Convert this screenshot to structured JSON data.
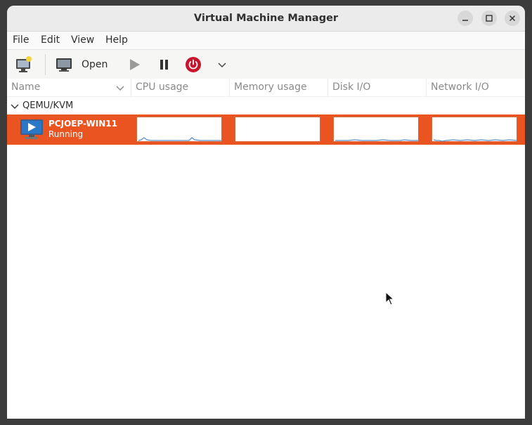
{
  "window": {
    "title": "Virtual Machine Manager"
  },
  "menu": [
    "File",
    "Edit",
    "View",
    "Help"
  ],
  "toolbar": {
    "open_label": "Open"
  },
  "columns": [
    "Name",
    "CPU usage",
    "Memory usage",
    "Disk I/O",
    "Network I/O"
  ],
  "group": {
    "label": "QEMU/KVM"
  },
  "vm": {
    "name": "PCJOEP-WIN11",
    "status": "Running"
  },
  "colors": {
    "selection": "#e95420",
    "shutdown": "#c7162b",
    "graph_line": "#5b8fc7"
  }
}
